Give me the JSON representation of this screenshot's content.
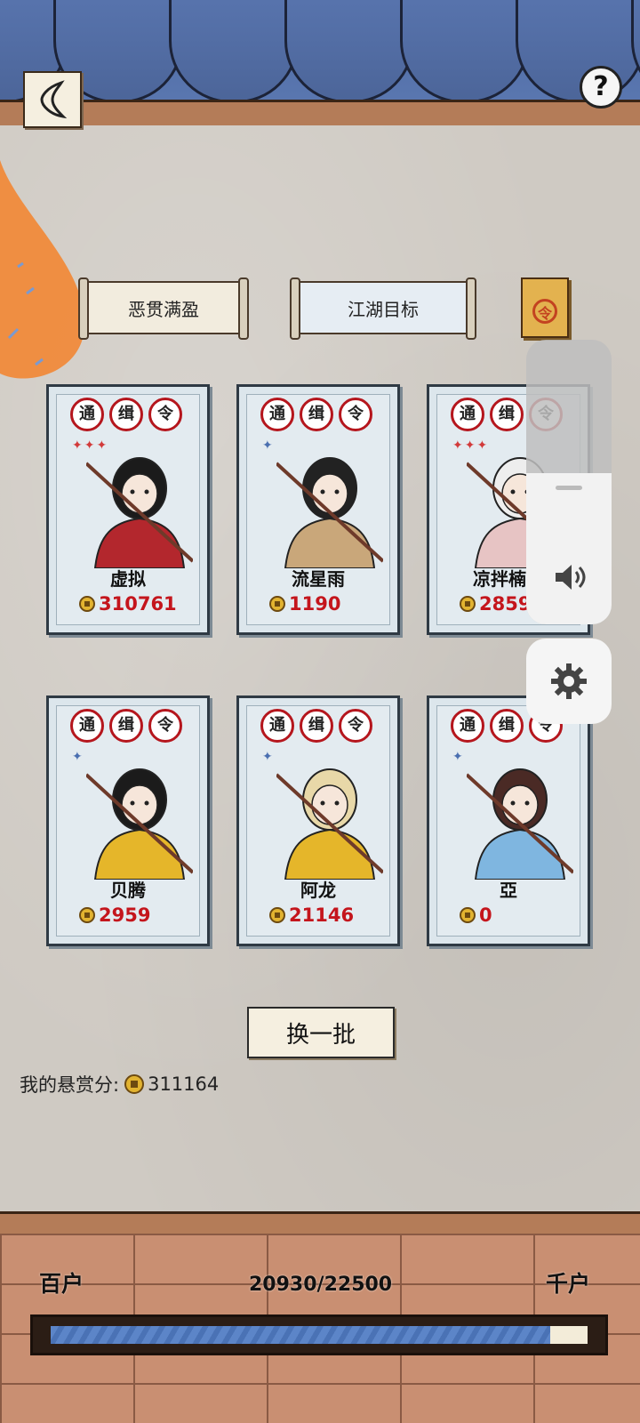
{
  "tabs": [
    {
      "label": "恶贯满盈"
    },
    {
      "label": "江湖目标"
    }
  ],
  "badges": [
    "通",
    "缉",
    "令"
  ],
  "cards": [
    {
      "name": "虚拟",
      "score": "310761",
      "stars": 3,
      "star_color": "#d23a3a"
    },
    {
      "name": "流星雨",
      "score": "1190",
      "stars": 1,
      "star_color": "#4a6fb0"
    },
    {
      "name": "凉拌楠娘",
      "score": "2859",
      "stars": 3,
      "star_color": "#d23a3a"
    },
    {
      "name": "贝腾",
      "score": "2959",
      "stars": 1,
      "star_color": "#4a6fb0"
    },
    {
      "name": "阿龙",
      "score": "21146",
      "stars": 1,
      "star_color": "#4a6fb0"
    },
    {
      "name": "亞",
      "score": "0",
      "stars": 1,
      "star_color": "#4a6fb0"
    }
  ],
  "refresh_button": {
    "label": "换一批"
  },
  "my_score": {
    "label": "我的悬赏分:",
    "value": "311164"
  },
  "rank": {
    "current": "百户",
    "next": "千户",
    "progress_text": "20930/22500",
    "progress_value": 20930,
    "progress_max": 22500
  },
  "volume": {
    "level": 0.53
  },
  "icons": {
    "back": "back-chevron-icon",
    "help": "question-mark-icon",
    "book": "book-seal-icon",
    "speaker": "speaker-icon",
    "settings": "gear-icon",
    "coin": "coin-icon"
  },
  "help_glyph": "?"
}
